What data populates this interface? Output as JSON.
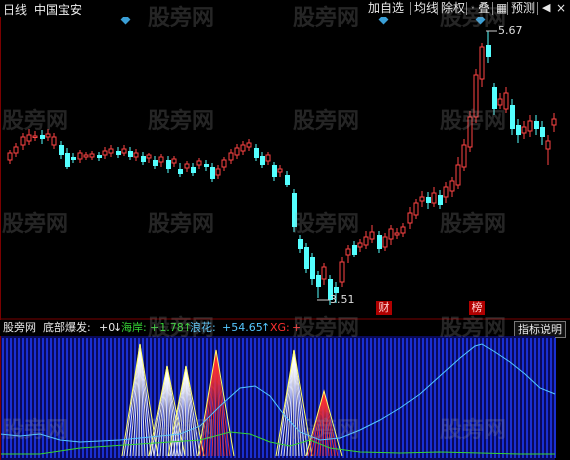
{
  "window": {
    "period_label": "日线",
    "stock_name": "中国宝安"
  },
  "toolbar": {
    "buttons": [
      "加自选",
      "均线",
      "除权",
      "叠",
      "预测"
    ],
    "close_glyph": "×",
    "sep_glyph": "·"
  },
  "price_panel": {
    "high_label": "5.67",
    "low_label": "3.51",
    "tag_cai": "财",
    "tag_bang": "榜",
    "colors": {
      "up": "#ff4444",
      "down": "#54ffff",
      "marker": "#3a9fd6"
    }
  },
  "indicator": {
    "name": "底部爆发:",
    "value_main": "+0",
    "arrow_main": "↓",
    "haian_label": "海岸:",
    "haian_value": "+1.78",
    "haian_arrow": "↑",
    "langhua_label": "浪花:",
    "langhua_value": "+54.65",
    "langhua_arrow": "↑",
    "xg_label": "XG:",
    "xg_value": "+",
    "explain_button": "指标说明",
    "colors": {
      "bars": "#1a2fd0",
      "bg": "#0a0a5a",
      "haian": "#35d435",
      "langhua": "#55c8ff",
      "xg": "#ff3030",
      "spike": "#ffffff"
    }
  },
  "watermark": "股旁网",
  "watermark_prefix": "股旁网"
}
